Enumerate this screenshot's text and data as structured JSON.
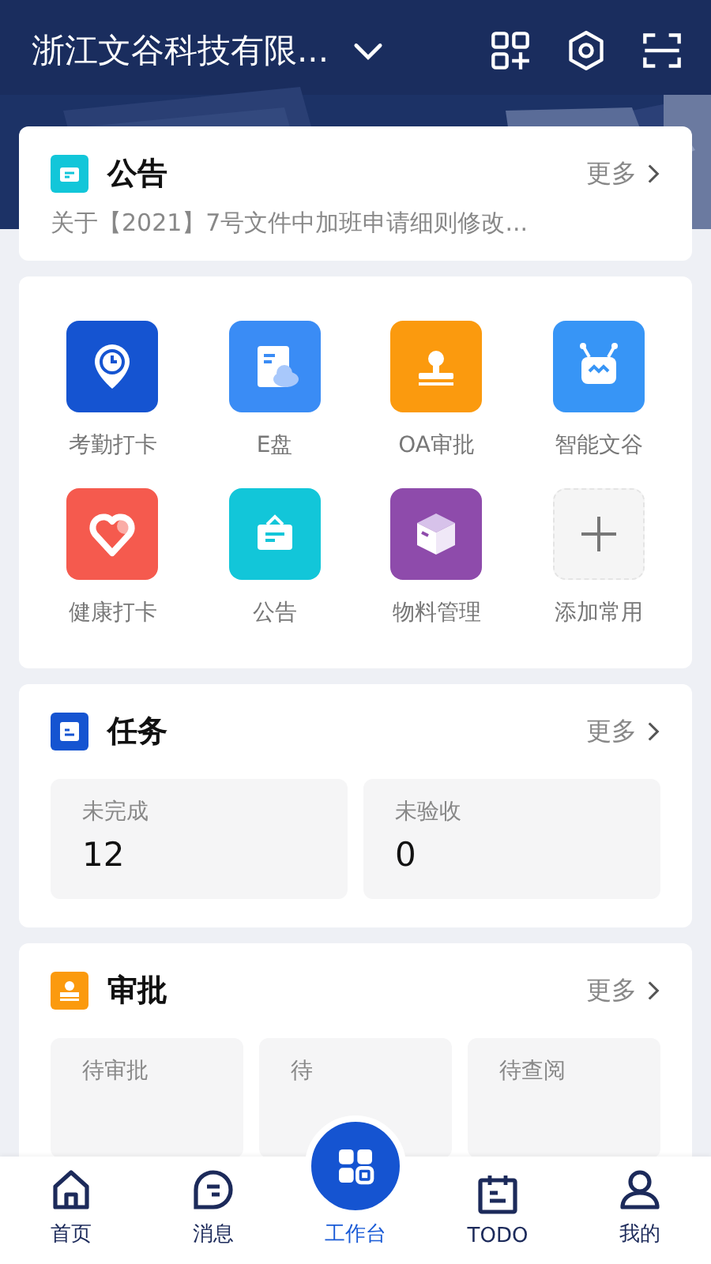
{
  "header": {
    "company": "浙江文谷科技有限..."
  },
  "notice": {
    "title": "公告",
    "more": "更多",
    "text": "关于【2021】7号文件中加班申请细则修改..."
  },
  "apps": [
    {
      "label": "考勤打卡",
      "kind": "app",
      "color": "#1554d1"
    },
    {
      "label": "E盘",
      "kind": "app",
      "color": "#3a8cf5"
    },
    {
      "label": "OA审批",
      "kind": "app",
      "color": "#fb9a0e"
    },
    {
      "label": "智能文谷",
      "kind": "app",
      "color": "#3795f6"
    },
    {
      "label": "健康打卡",
      "kind": "app",
      "color": "#f55a4e"
    },
    {
      "label": "公告",
      "kind": "app",
      "color": "#12c6d9"
    },
    {
      "label": "物料管理",
      "kind": "app",
      "color": "#8e4bab"
    },
    {
      "label": "添加常用",
      "kind": "add"
    }
  ],
  "tasks": {
    "title": "任务",
    "more": "更多",
    "stats": [
      {
        "label": "未完成",
        "value": "12"
      },
      {
        "label": "未验收",
        "value": "0"
      }
    ]
  },
  "approval": {
    "title": "审批",
    "more": "更多",
    "stats": [
      {
        "label": "待审批"
      },
      {
        "label": "待"
      },
      {
        "label": "待查阅"
      }
    ]
  },
  "tabs": [
    {
      "label": "首页",
      "selected": false
    },
    {
      "label": "消息",
      "selected": false
    },
    {
      "label": "工作台",
      "selected": true
    },
    {
      "label": "TODO",
      "selected": false
    },
    {
      "label": "我的",
      "selected": false
    }
  ]
}
